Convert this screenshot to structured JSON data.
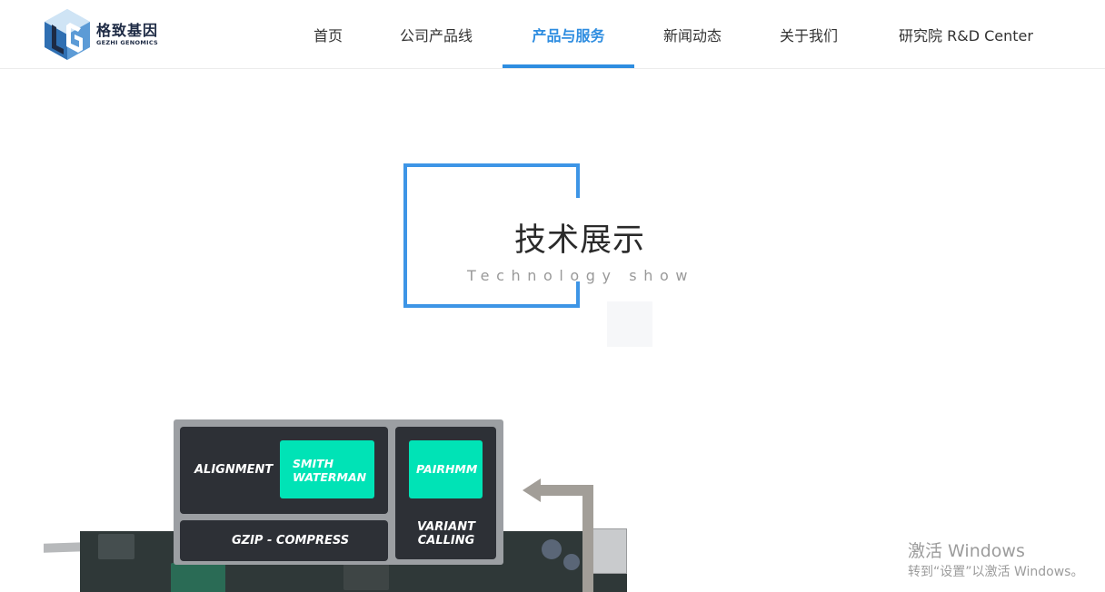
{
  "brand": {
    "name_cn": "格致基因",
    "name_en": "GEZHI GENOMICS",
    "logo_icon": "hexagon-lg-logo",
    "colors": {
      "dark": "#1d2a44",
      "mid": "#3a7fc3",
      "light": "#9fc9ea"
    }
  },
  "nav": {
    "items": [
      {
        "label": "首页"
      },
      {
        "label": "公司产品线"
      },
      {
        "label": "产品与服务"
      },
      {
        "label": "新闻动态"
      },
      {
        "label": "关于我们"
      },
      {
        "label": "研究院 R&D Center"
      }
    ],
    "active_index": 2,
    "active_color": "#2e8de0"
  },
  "section": {
    "title_cn": "技术展示",
    "title_en": "Technology show",
    "accent_color": "#3d95e6"
  },
  "diagram": {
    "panels": [
      {
        "label": "ALIGNMENT"
      },
      {
        "label": "GZIP - COMPRESS"
      },
      {
        "label": "VARIANT CALLING"
      }
    ],
    "chips": [
      {
        "label": "SMITH WATERMAN"
      },
      {
        "label": "PAIRHMM"
      }
    ],
    "chip_color": "#00e3b6",
    "panel_color": "#2d3036",
    "arrow_icon": "return-arrow-icon"
  },
  "watermark": {
    "title": "激活 Windows",
    "subtitle": "转到“设置”以激活 Windows。"
  }
}
